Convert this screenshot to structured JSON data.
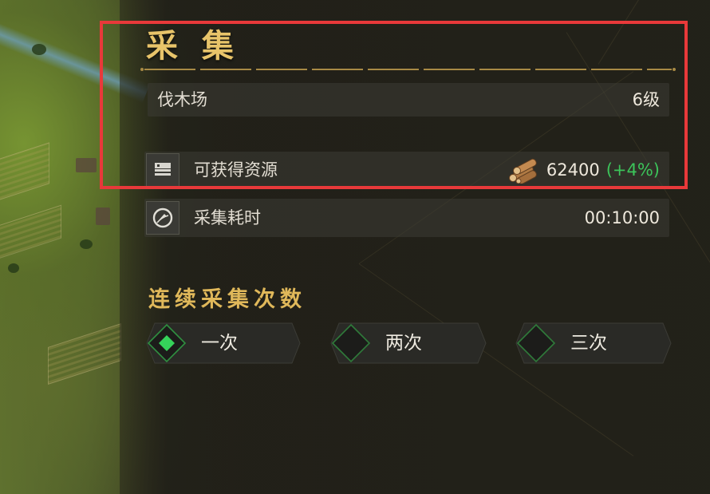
{
  "panel": {
    "title": "采 集",
    "building": {
      "name": "伐木场",
      "level": "6级"
    },
    "resource": {
      "label": "可获得资源",
      "icon": "logs-icon",
      "amount": "62400",
      "bonus": "(+4%)"
    },
    "duration": {
      "label": "采集耗时",
      "value": "00:10:00"
    },
    "repeat": {
      "title": "连续采集次数",
      "options": [
        {
          "label": "一次",
          "selected": true
        },
        {
          "label": "两次",
          "selected": false
        },
        {
          "label": "三次",
          "selected": false
        }
      ]
    }
  },
  "colors": {
    "gold": "#e8c46a",
    "bonus_green": "#3cc45a",
    "selected_green": "#35d35a",
    "highlight_red": "#e8393a"
  }
}
